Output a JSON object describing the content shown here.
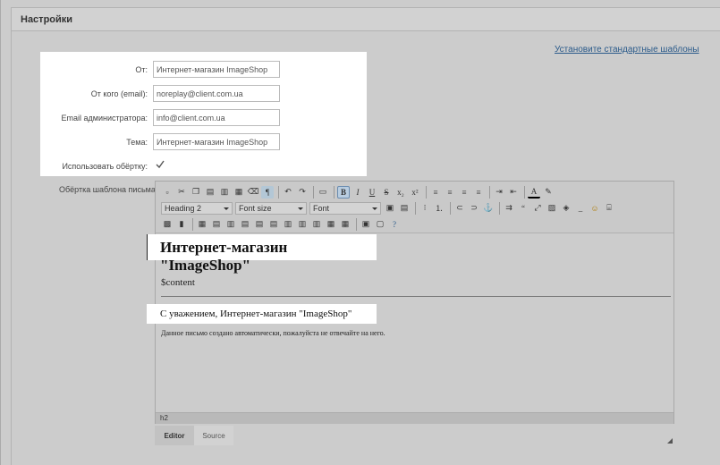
{
  "header": {
    "title": "Настройки"
  },
  "reset_link": "Установите стандартные шаблоны",
  "form": {
    "from": {
      "label": "От:",
      "value": "Интернет-магазин ImageShop"
    },
    "from_email": {
      "label": "От кого (email):",
      "value": "noreplay@client.com.ua"
    },
    "admin_email": {
      "label": "Email администратора:",
      "value": "info@client.com.ua"
    },
    "subject": {
      "label": "Тема:",
      "value": "Интернет-магазин ImageShop"
    },
    "use_wrapper": {
      "label": "Использовать обёртку:",
      "checked": true
    }
  },
  "editor": {
    "label": "Обёртка шаблона письма:",
    "format_select": "Heading 2",
    "size_select": "Font size",
    "font_select": "Font",
    "content": {
      "heading": "Интернет-магазин \"ImageShop\"",
      "variable": "$content",
      "signature": "С уважением, Интернет-магазин \"ImageShop\"",
      "note": "Данное письмо создано автоматически, пожалуйста не отвечайте на него."
    },
    "status_path": "h2",
    "tabs": {
      "editor": "Editor",
      "source": "Source"
    }
  }
}
